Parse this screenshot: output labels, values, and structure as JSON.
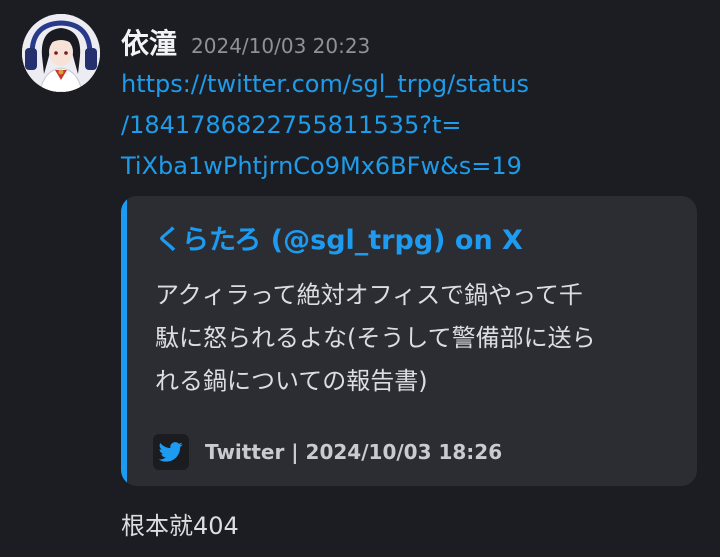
{
  "message": {
    "author": "依潼",
    "timestamp": "2024/10/03 20:23",
    "link_lines": [
      "https://twitter.com/sgl_trpg/status",
      "/1841786822755811535?t=",
      "TiXba1wPhtjrnCo9Mx6BFw&s=19"
    ],
    "avatar_icon": "user-avatar-icon",
    "reply_text": "根本就404"
  },
  "embed": {
    "accent_color": "#1d9bf0",
    "title": "くらたろ (@sgl_trpg) on X",
    "description_lines": [
      "アクィラって絶対オフィスで鍋やって千",
      "駄に怒られるよな(そうして警備部に送ら",
      "れる鍋についての報告書)"
    ],
    "footer": "Twitter | 2024/10/03 18:26",
    "footer_icon": "twitter-bird-icon"
  }
}
